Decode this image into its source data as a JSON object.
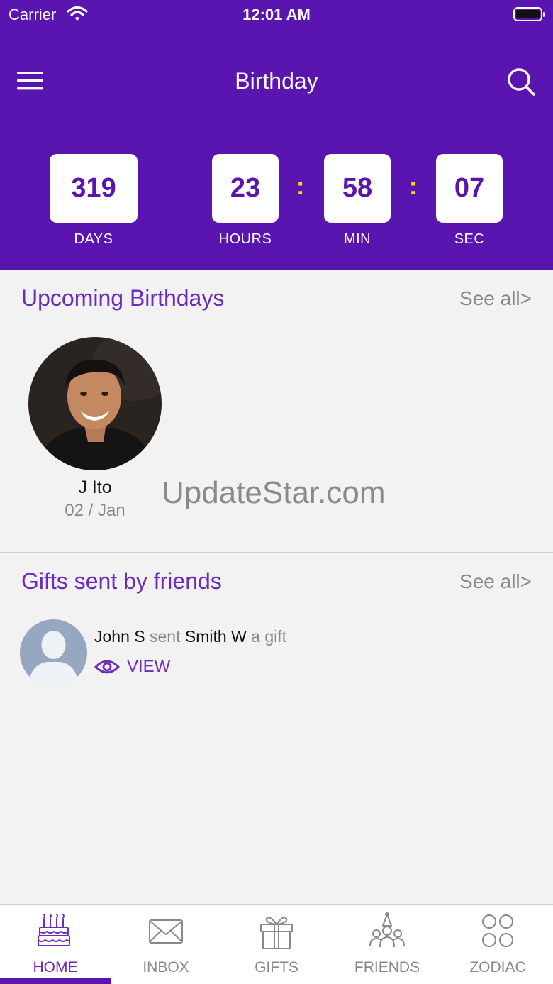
{
  "status_bar": {
    "carrier": "Carrier",
    "time": "12:01 AM"
  },
  "header": {
    "title": "Birthday",
    "icons": {
      "menu": "menu-icon",
      "search": "search-icon"
    },
    "background_color": "#5a14b0"
  },
  "countdown": {
    "days": "319",
    "hours": "23",
    "minutes": "58",
    "seconds": "07",
    "days_label": "DAYS",
    "hours_label": "HOURS",
    "minutes_label": "MIN",
    "seconds_label": "SEC",
    "separator": ":",
    "separator_color": "#f2e600"
  },
  "upcoming": {
    "title": "Upcoming Birthdays",
    "see_all": "See all>",
    "people": [
      {
        "name": "J  Ito",
        "date": "02 / Jan"
      }
    ]
  },
  "watermark": "UpdateStar.com",
  "gifts": {
    "title": "Gifts sent by friends",
    "see_all": "See all>",
    "items": [
      {
        "sender": "John S",
        "verb": "sent",
        "recipient": "Smith W",
        "suffix": "a gift",
        "action": "VIEW"
      }
    ]
  },
  "tabbar": {
    "active": "HOME",
    "accent_color": "#6b2bbd",
    "tabs": [
      {
        "label": "HOME",
        "icon": "birthday-cake-icon"
      },
      {
        "label": "INBOX",
        "icon": "envelope-icon"
      },
      {
        "label": "GIFTS",
        "icon": "gift-box-icon"
      },
      {
        "label": "FRIENDS",
        "icon": "friends-party-icon"
      },
      {
        "label": "ZODIAC",
        "icon": "zodiac-grid-icon"
      }
    ]
  }
}
